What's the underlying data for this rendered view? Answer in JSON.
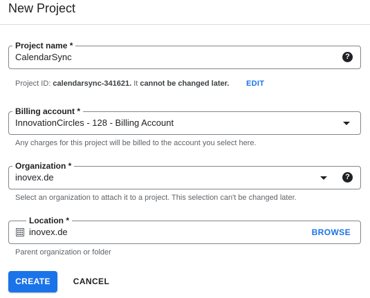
{
  "dialog": {
    "title": "New Project"
  },
  "project_name": {
    "label": "Project name *",
    "value": "CalendarSync",
    "help_icon": "?"
  },
  "project_id": {
    "prefix": "Project ID: ",
    "id": "calendarsync-341621.",
    "middle": " It ",
    "emphasis": "cannot be changed later.",
    "edit_label": "EDIT"
  },
  "billing_account": {
    "label": "Billing account *",
    "value": "InnovationCircles - 128 - Billing Account",
    "hint": "Any charges for this project will be billed to the account you select here."
  },
  "organization": {
    "label": "Organization *",
    "value": "inovex.de",
    "help_icon": "?",
    "hint": "Select an organization to attach it to a project. This selection can't be changed later."
  },
  "location": {
    "label": "Location *",
    "value": "inovex.de",
    "browse_label": "BROWSE",
    "hint": "Parent organization or folder"
  },
  "actions": {
    "create_label": "CREATE",
    "cancel_label": "CANCEL"
  },
  "colors": {
    "accent": "#1a73e8",
    "text": "#202124",
    "hint": "#5f6368",
    "border": "#80868b"
  }
}
